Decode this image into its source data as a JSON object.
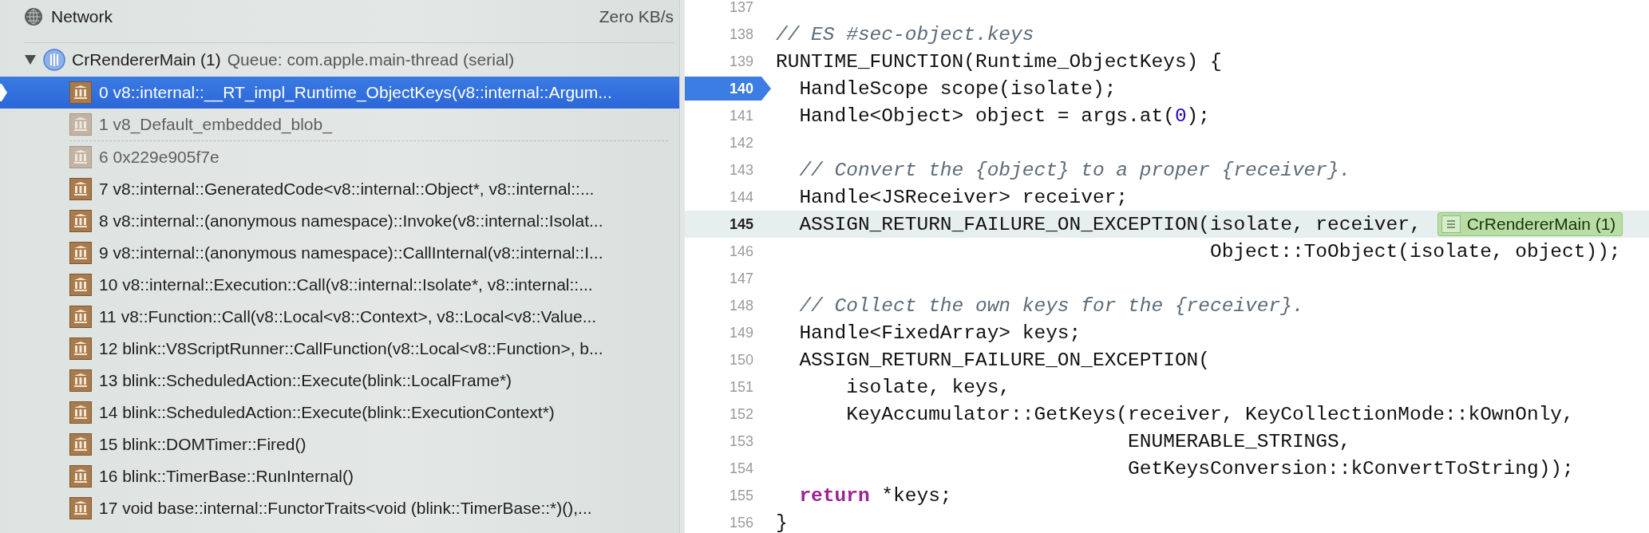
{
  "network": {
    "label": "Network",
    "rate": "Zero KB/s"
  },
  "thread": {
    "name": "CrRendererMain (1)",
    "queue": "Queue: com.apple.main-thread (serial)",
    "expanded": true
  },
  "frames": [
    {
      "label": "0 v8::internal::__RT_impl_Runtime_ObjectKeys(v8::internal::Argum...",
      "selected": true,
      "dimmed": false
    },
    {
      "label": "1 v8_Default_embedded_blob_",
      "selected": false,
      "dimmed": true
    },
    {
      "label": "6 0x229e905f7e",
      "selected": false,
      "dimmed": true,
      "elided_before": true
    },
    {
      "label": "7 v8::internal::GeneratedCode<v8::internal::Object*, v8::internal::...",
      "selected": false,
      "dimmed": false
    },
    {
      "label": "8 v8::internal::(anonymous namespace)::Invoke(v8::internal::Isolat...",
      "selected": false,
      "dimmed": false
    },
    {
      "label": "9 v8::internal::(anonymous namespace)::CallInternal(v8::internal::I...",
      "selected": false,
      "dimmed": false
    },
    {
      "label": "10 v8::internal::Execution::Call(v8::internal::Isolate*, v8::internal::...",
      "selected": false,
      "dimmed": false
    },
    {
      "label": "11 v8::Function::Call(v8::Local<v8::Context>, v8::Local<v8::Value...",
      "selected": false,
      "dimmed": false
    },
    {
      "label": "12 blink::V8ScriptRunner::CallFunction(v8::Local<v8::Function>, b...",
      "selected": false,
      "dimmed": false
    },
    {
      "label": "13 blink::ScheduledAction::Execute(blink::LocalFrame*)",
      "selected": false,
      "dimmed": false
    },
    {
      "label": "14 blink::ScheduledAction::Execute(blink::ExecutionContext*)",
      "selected": false,
      "dimmed": false
    },
    {
      "label": "15 blink::DOMTimer::Fired()",
      "selected": false,
      "dimmed": false
    },
    {
      "label": "16 blink::TimerBase::RunInternal()",
      "selected": false,
      "dimmed": false
    },
    {
      "label": "17 void base::internal::FunctorTraits<void (blink::TimerBase::*)(),...",
      "selected": false,
      "dimmed": false
    }
  ],
  "editor": {
    "lines": [
      {
        "number": "137",
        "current": false,
        "highlighted": false
      },
      {
        "number": "138",
        "current": false,
        "highlighted": false,
        "tokens": [
          {
            "text": "// ES #sec-object.keys",
            "kind": "comment"
          }
        ]
      },
      {
        "number": "139",
        "current": false,
        "highlighted": false,
        "tokens": [
          {
            "text": "RUNTIME_FUNCTION(Runtime_ObjectKeys) {",
            "kind": "plain"
          }
        ]
      },
      {
        "number": "140",
        "current": true,
        "highlighted": false,
        "tokens": [
          {
            "text": "  HandleScope scope(isolate);",
            "kind": "plain"
          }
        ]
      },
      {
        "number": "141",
        "current": false,
        "highlighted": false,
        "tokens": [
          {
            "text": "  Handle<Object> object = args.at(",
            "kind": "plain"
          },
          {
            "text": "0",
            "kind": "number"
          },
          {
            "text": ");",
            "kind": "plain"
          }
        ]
      },
      {
        "number": "142",
        "current": false,
        "highlighted": false
      },
      {
        "number": "143",
        "current": false,
        "highlighted": false,
        "tokens": [
          {
            "text": "  // Convert the {object} to a proper {receiver}.",
            "kind": "comment"
          }
        ]
      },
      {
        "number": "144",
        "current": false,
        "highlighted": false,
        "tokens": [
          {
            "text": "  Handle<JSReceiver> receiver;",
            "kind": "plain"
          }
        ]
      },
      {
        "number": "145",
        "current": false,
        "highlighted": true,
        "tokens": [
          {
            "text": "  ASSIGN_RETURN_FAILURE_ON_EXCEPTION(isolate, receiver,",
            "kind": "plain"
          }
        ],
        "annotation": "CrRendererMain (1)"
      },
      {
        "number": "146",
        "current": false,
        "highlighted": false,
        "tokens": [
          {
            "text": "                                     Object::ToObject(isolate, object));",
            "kind": "plain"
          }
        ]
      },
      {
        "number": "147",
        "current": false,
        "highlighted": false
      },
      {
        "number": "148",
        "current": false,
        "highlighted": false,
        "tokens": [
          {
            "text": "  // Collect the own keys for the {receiver}.",
            "kind": "comment"
          }
        ]
      },
      {
        "number": "149",
        "current": false,
        "highlighted": false,
        "tokens": [
          {
            "text": "  Handle<FixedArray> keys;",
            "kind": "plain"
          }
        ]
      },
      {
        "number": "150",
        "current": false,
        "highlighted": false,
        "tokens": [
          {
            "text": "  ASSIGN_RETURN_FAILURE_ON_EXCEPTION(",
            "kind": "plain"
          }
        ]
      },
      {
        "number": "151",
        "current": false,
        "highlighted": false,
        "tokens": [
          {
            "text": "      isolate, keys,",
            "kind": "plain"
          }
        ]
      },
      {
        "number": "152",
        "current": false,
        "highlighted": false,
        "tokens": [
          {
            "text": "      KeyAccumulator::GetKeys(receiver, KeyCollectionMode::kOwnOnly,",
            "kind": "plain"
          }
        ]
      },
      {
        "number": "153",
        "current": false,
        "highlighted": false,
        "tokens": [
          {
            "text": "                              ENUMERABLE_STRINGS,",
            "kind": "plain"
          }
        ]
      },
      {
        "number": "154",
        "current": false,
        "highlighted": false,
        "tokens": [
          {
            "text": "                              GetKeysConversion::kConvertToString));",
            "kind": "plain"
          }
        ]
      },
      {
        "number": "155",
        "current": false,
        "highlighted": false,
        "tokens": [
          {
            "text": "  return",
            "kind": "keyword"
          },
          {
            "text": " *keys;",
            "kind": "plain"
          }
        ]
      },
      {
        "number": "156",
        "current": false,
        "highlighted": false,
        "tokens": [
          {
            "text": "}",
            "kind": "plain"
          }
        ]
      }
    ]
  }
}
